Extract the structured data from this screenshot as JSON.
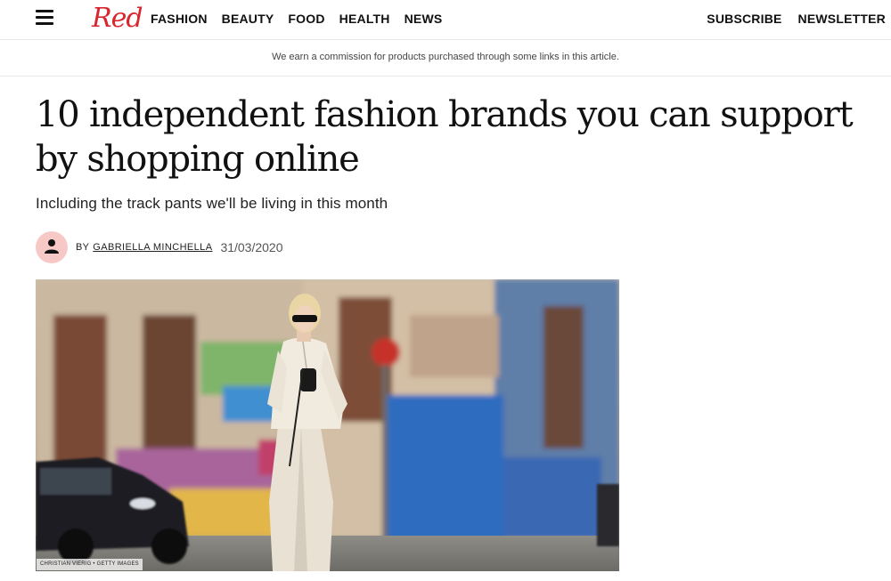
{
  "header": {
    "logo_text": "Red",
    "nav_links": [
      "FASHION",
      "BEAUTY",
      "FOOD",
      "HEALTH",
      "NEWS"
    ],
    "subscribe_label": "SUBSCRIBE",
    "newsletter_label": "NEWSLETTER"
  },
  "disclaimer": "We earn a commission for products purchased through some links in this article.",
  "article": {
    "headline": "10 independent fashion brands you can support by shopping online",
    "dek": "Including the track pants we'll be living in this month",
    "byline_prefix": "BY",
    "author": "GABRIELLA MINCHELLA",
    "date": "31/03/2020",
    "image_credit": "CHRISTIAN VIERIG • GETTY IMAGES"
  },
  "colors": {
    "brand": "#d8262f",
    "avatar_bg": "#f7c9c6"
  },
  "icons": {
    "menu": "hamburger-icon",
    "avatar": "person-icon"
  }
}
